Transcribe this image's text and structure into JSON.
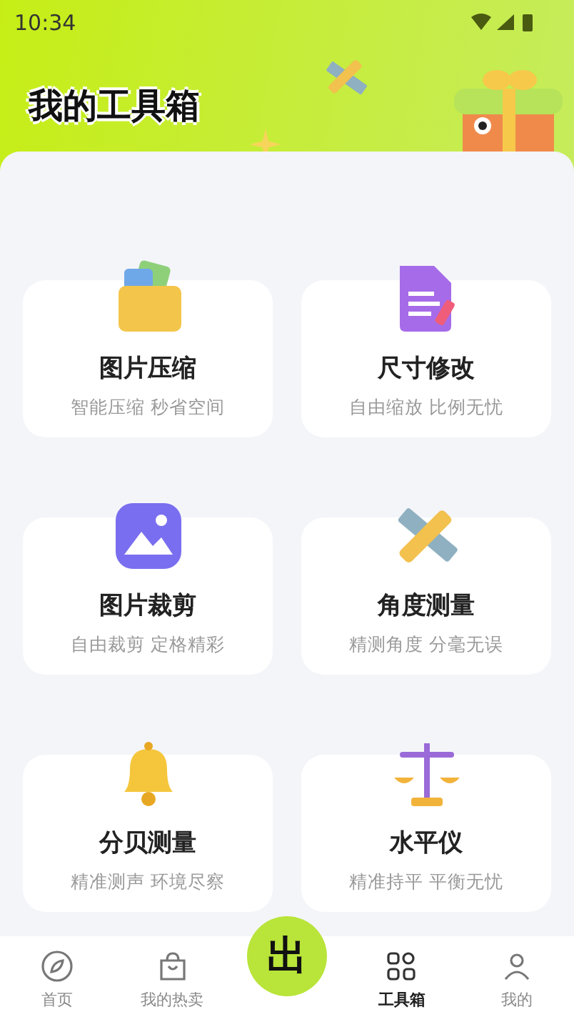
{
  "status_bar": {
    "time": "10:34"
  },
  "header": {
    "title": "我的工具箱"
  },
  "tools": [
    {
      "kind": "folder",
      "title": "图片压缩",
      "subtitle": "智能压缩 秒省空间"
    },
    {
      "kind": "document",
      "title": "尺寸修改",
      "subtitle": "自由缩放 比例无忧"
    },
    {
      "kind": "image",
      "title": "图片裁剪",
      "subtitle": "自由裁剪 定格精彩"
    },
    {
      "kind": "ruler",
      "title": "角度测量",
      "subtitle": "精测角度 分毫无误"
    },
    {
      "kind": "bell",
      "title": "分贝测量",
      "subtitle": "精准测声 环境尽察"
    },
    {
      "kind": "scale",
      "title": "水平仪",
      "subtitle": "精准持平 平衡无忧"
    }
  ],
  "center_button": {
    "label": "出"
  },
  "bottom_nav": [
    {
      "kind": "compass",
      "label": "首页",
      "selected": false
    },
    {
      "kind": "bag",
      "label": "我的热卖",
      "selected": false
    },
    {
      "kind": "center"
    },
    {
      "kind": "toolbox",
      "label": "工具箱",
      "selected": true
    },
    {
      "kind": "person",
      "label": "我的",
      "selected": false
    }
  ]
}
